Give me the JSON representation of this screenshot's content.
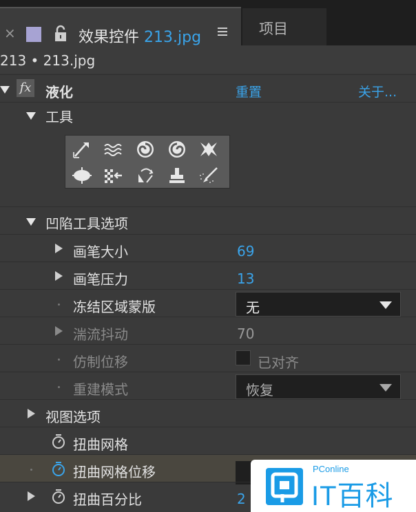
{
  "tabs": {
    "close_glyph": "×",
    "active_title_prefix": "效果控件",
    "active_title_file": "213.jpg",
    "inactive_title": "项目"
  },
  "breadcrumb": "213 • 213.jpg",
  "effect": {
    "fx": "fx",
    "name": "液化",
    "reset": "重置",
    "about": "关于..."
  },
  "tools_group": {
    "label": "工具"
  },
  "tool_icons": [
    "warp-icon",
    "turbulence-icon",
    "twirl-cw-icon",
    "twirl-ccw-icon",
    "pucker-icon",
    "bloat-icon",
    "shift-pixels-icon",
    "reflection-icon",
    "clone-stamp-icon",
    "reconstruction-icon"
  ],
  "warp_options": {
    "label": "凹陷工具选项",
    "brush_size": {
      "label": "画笔大小",
      "value": "69"
    },
    "brush_pressure": {
      "label": "画笔压力",
      "value": "13"
    },
    "freeze_mask": {
      "label": "冻结区域蒙版",
      "value": "无"
    },
    "turbulent_jitter": {
      "label": "湍流抖动",
      "value": "70"
    },
    "clone_offset": {
      "label": "仿制位移",
      "checkbox_label": "已对齐"
    },
    "reconstruction_mode": {
      "label": "重建模式",
      "value": "恢复"
    }
  },
  "view_options": {
    "label": "视图选项"
  },
  "distortion_mesh": {
    "label": "扭曲网格"
  },
  "mesh_offset": {
    "label": "扭曲网格位移"
  },
  "distortion_percent": {
    "label": "扭曲百分比",
    "value_partial": "2"
  },
  "watermark": {
    "small": "PConline",
    "main": "IT百科"
  },
  "colors": {
    "accent": "#3aa4ea",
    "panel": "#3a3a3a",
    "highlight": "#4a473f"
  }
}
